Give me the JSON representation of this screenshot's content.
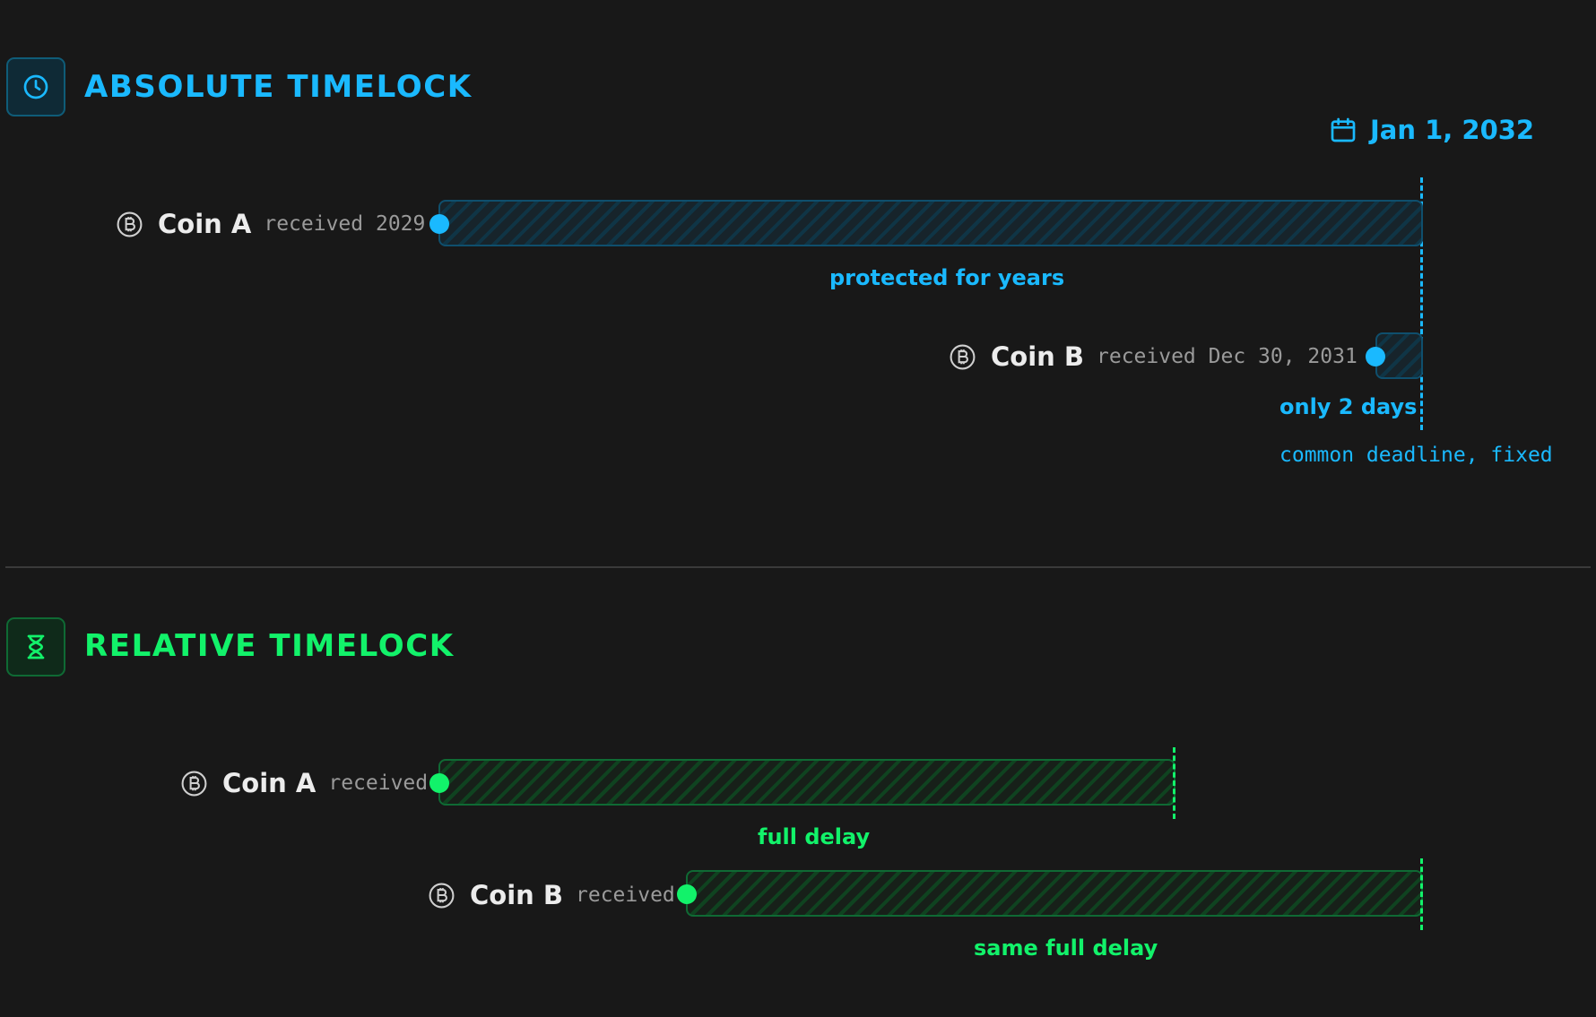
{
  "colors": {
    "absolute": "#1ab9ff",
    "relative": "#12f26a",
    "background": "#181818"
  },
  "absolute": {
    "icon": "clock-icon",
    "title": "ABSOLUTE TIMELOCK",
    "deadline": {
      "icon": "calendar-icon",
      "label": "Jan 1, 2032"
    },
    "coin_a": {
      "icon": "bitcoin-icon",
      "name": "Coin A",
      "received": "received 2029",
      "caption": "protected for years"
    },
    "coin_b": {
      "icon": "bitcoin-icon",
      "name": "Coin B",
      "received": "received Dec 30, 2031",
      "caption": "only 2 days"
    },
    "note": "common deadline, fixed"
  },
  "relative": {
    "icon": "hourglass-icon",
    "title": "RELATIVE TIMELOCK",
    "coin_a": {
      "icon": "bitcoin-icon",
      "name": "Coin A",
      "received": "received",
      "caption": "full delay"
    },
    "coin_b": {
      "icon": "bitcoin-icon",
      "name": "Coin B",
      "received": "received",
      "caption": "same full delay"
    }
  }
}
